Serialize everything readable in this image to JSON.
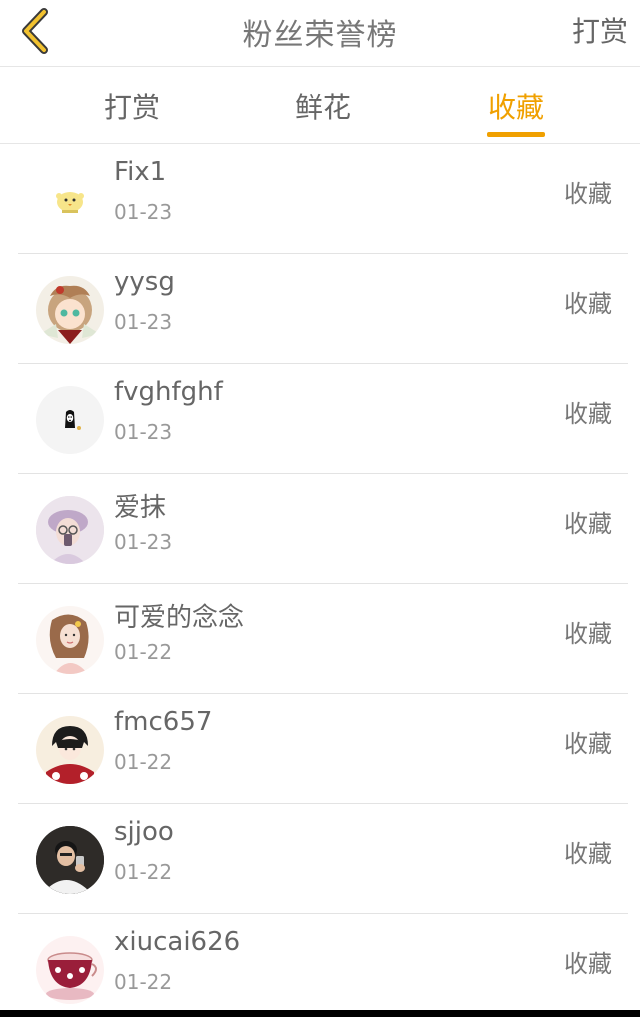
{
  "header": {
    "title": "粉丝荣誉榜",
    "right_action": "打赏"
  },
  "tabs": [
    {
      "label": "打赏",
      "active": false
    },
    {
      "label": "鲜花",
      "active": false
    },
    {
      "label": "收藏",
      "active": true
    }
  ],
  "colors": {
    "accent": "#f0a000",
    "text": "#666666",
    "subtext": "#999999",
    "divider": "#e3e3e3"
  },
  "fans": [
    {
      "name": "Fix1",
      "date": "01-23",
      "action": "收藏",
      "avatar": "chick-avatar"
    },
    {
      "name": "yysg",
      "date": "01-23",
      "action": "收藏",
      "avatar": "anime-girl-avatar"
    },
    {
      "name": "fvghfghf",
      "date": "01-23",
      "action": "收藏",
      "avatar": "ghost-avatar"
    },
    {
      "name": "爱抹",
      "date": "01-23",
      "action": "收藏",
      "avatar": "girl-glasses-avatar"
    },
    {
      "name": "可爱的念念",
      "date": "01-22",
      "action": "收藏",
      "avatar": "girl-drawing-avatar"
    },
    {
      "name": "fmc657",
      "date": "01-22",
      "action": "收藏",
      "avatar": "anime-boy-avatar"
    },
    {
      "name": "sjjoo",
      "date": "01-22",
      "action": "收藏",
      "avatar": "man-phone-avatar"
    },
    {
      "name": "xiucai626",
      "date": "01-22",
      "action": "收藏",
      "avatar": "teacup-avatar"
    }
  ]
}
